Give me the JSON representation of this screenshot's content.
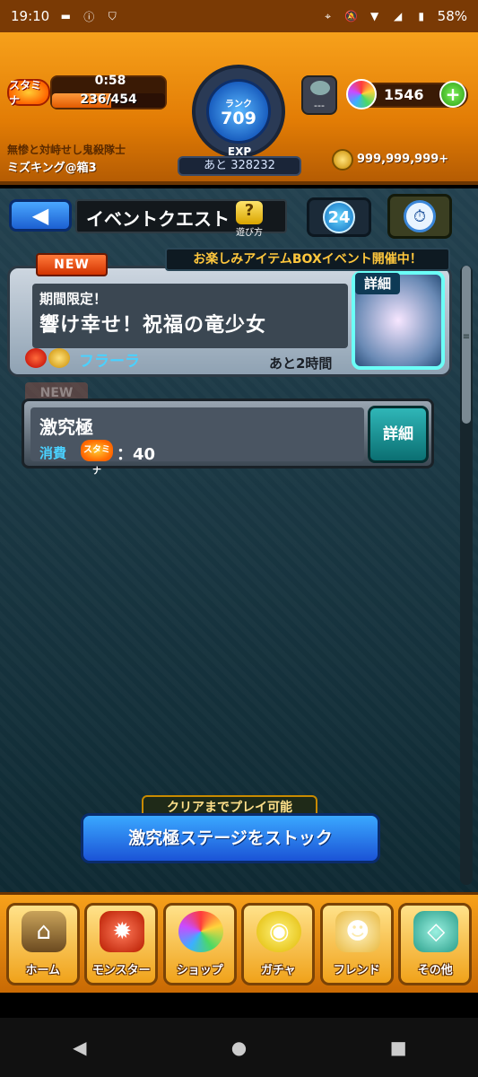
{
  "status_bar": {
    "time": "19:10",
    "battery": "58%",
    "icons_left": [
      "message-icon",
      "info-icon",
      "shield-icon"
    ],
    "icons_right": [
      "location-icon",
      "mute-icon",
      "wifi-icon",
      "signal-icon",
      "battery-icon"
    ]
  },
  "header": {
    "stamina_icon_label": "スタミナ",
    "stamina_timer": "0:58",
    "stamina_value": "236/454",
    "stamina_fraction": 0.52,
    "player_title": "無惨と対峙せし鬼殺隊士",
    "player_name": "ミズキング@箱3",
    "rank_label": "ランク",
    "rank": "709",
    "exp_label": "EXP",
    "exp_remaining": "あと 328232",
    "robot_value": "---",
    "orbs": "1546",
    "coins": "999,999,999+"
  },
  "nav": {
    "back_icon": "◀",
    "title": "イベントクエスト",
    "help_icon": "?",
    "help_label": "遊び方",
    "badge_number": "24"
  },
  "event": {
    "new_label": "NEW",
    "box_event": "お楽しみアイテムBOXイベント開催中！",
    "tag": "期間限定！",
    "title": "響け幸せ！祝福の竜少女",
    "boss": "フラーラ",
    "time_left": "あと2時間",
    "detail_label": "詳細"
  },
  "quest": {
    "new_label": "NEW",
    "name": "激究極",
    "cost_label": "消費",
    "stamina_icon_label": "スタミナ",
    "cost_value": "：40",
    "detail_label": "詳細"
  },
  "actions": {
    "clear_hint": "クリアまでプレイ可能",
    "stock_button": "激究極ステージをストック"
  },
  "tabs": [
    {
      "label": "ホーム",
      "icon": "home-icon"
    },
    {
      "label": "モンスター",
      "icon": "monster-icon"
    },
    {
      "label": "ショップ",
      "icon": "shop-icon"
    },
    {
      "label": "ガチャ",
      "icon": "gacha-icon"
    },
    {
      "label": "フレンド",
      "icon": "friend-icon"
    },
    {
      "label": "その他",
      "icon": "other-icon"
    }
  ],
  "android_nav": [
    "back-icon",
    "home-icon",
    "recents-icon"
  ]
}
